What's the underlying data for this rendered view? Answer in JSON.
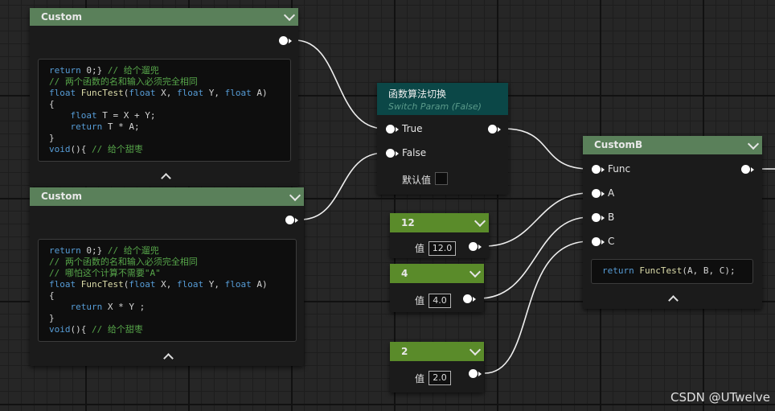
{
  "custom_node_1": {
    "title": "Custom",
    "code": [
      [
        [
          "kw",
          "return"
        ],
        [
          "tx",
          " 0;} "
        ],
        [
          "cm",
          "// 给个遛兜"
        ]
      ],
      [
        [
          "cm",
          "// 两个函数的名和输入必须完全相同"
        ]
      ],
      [
        [
          "kw",
          "float"
        ],
        [
          "tx",
          " "
        ],
        [
          "fn",
          "FuncTest"
        ],
        [
          "tx",
          "("
        ],
        [
          "kw",
          "float"
        ],
        [
          "tx",
          " X, "
        ],
        [
          "kw",
          "float"
        ],
        [
          "tx",
          " Y, "
        ],
        [
          "kw",
          "float"
        ],
        [
          "tx",
          " A)"
        ]
      ],
      [
        [
          "tx",
          "{"
        ]
      ],
      [
        [
          "tx",
          "    "
        ],
        [
          "kw",
          "float"
        ],
        [
          "tx",
          " T = X + Y;"
        ]
      ],
      [
        [
          "tx",
          "    "
        ],
        [
          "kw",
          "return"
        ],
        [
          "tx",
          " T * A;"
        ]
      ],
      [
        [
          "tx",
          "}"
        ]
      ],
      [
        [
          "kw",
          "void"
        ],
        [
          "tx",
          "(){ "
        ],
        [
          "cm",
          "// 给个甜枣"
        ]
      ]
    ]
  },
  "custom_node_2": {
    "title": "Custom",
    "code": [
      [
        [
          "kw",
          "return"
        ],
        [
          "tx",
          " 0;} "
        ],
        [
          "cm",
          "// 给个遛兜"
        ]
      ],
      [
        [
          "cm",
          "// 两个函数的名和输入必须完全相同"
        ]
      ],
      [
        [
          "cm",
          "// 哪怕这个计算不需要\"A\""
        ]
      ],
      [
        [
          "kw",
          "float"
        ],
        [
          "tx",
          " "
        ],
        [
          "fn",
          "FuncTest"
        ],
        [
          "tx",
          "("
        ],
        [
          "kw",
          "float"
        ],
        [
          "tx",
          " X, "
        ],
        [
          "kw",
          "float"
        ],
        [
          "tx",
          " Y, "
        ],
        [
          "kw",
          "float"
        ],
        [
          "tx",
          " A)"
        ]
      ],
      [
        [
          "tx",
          "{"
        ]
      ],
      [
        [
          "tx",
          "    "
        ],
        [
          "kw",
          "return"
        ],
        [
          "tx",
          " X * Y ;"
        ]
      ],
      [
        [
          "tx",
          "}"
        ]
      ],
      [
        [
          "kw",
          "void"
        ],
        [
          "tx",
          "(){ "
        ],
        [
          "cm",
          "// 给个甜枣"
        ]
      ]
    ]
  },
  "switch_node": {
    "title": "函数算法切换",
    "subtitle": "Switch Param (False)",
    "true_label": "True",
    "false_label": "False",
    "default_label": "默认值"
  },
  "const_nodes": [
    {
      "title": "12",
      "value_label": "值",
      "value": "12.0"
    },
    {
      "title": "4",
      "value_label": "值",
      "value": "4.0"
    },
    {
      "title": "2",
      "value_label": "值",
      "value": "2.0"
    }
  ],
  "customb_node": {
    "title": "CustomB",
    "inputs": [
      "Func",
      "A",
      "B",
      "C"
    ],
    "code": [
      [
        [
          "kw",
          "return"
        ],
        [
          "tx",
          " "
        ],
        [
          "fn",
          "FuncTest"
        ],
        [
          "tx",
          "(A, B, C);"
        ]
      ]
    ]
  },
  "watermark": "CSDN @UTwelve",
  "colors": {
    "custom_header": "#5a805a",
    "switch_header": "#0b4747",
    "const_header": "#5a8b2a",
    "wire": "#f2f2f2"
  },
  "icons": [
    "chevron-down-icon",
    "chevron-up-icon",
    "pin-icon"
  ]
}
